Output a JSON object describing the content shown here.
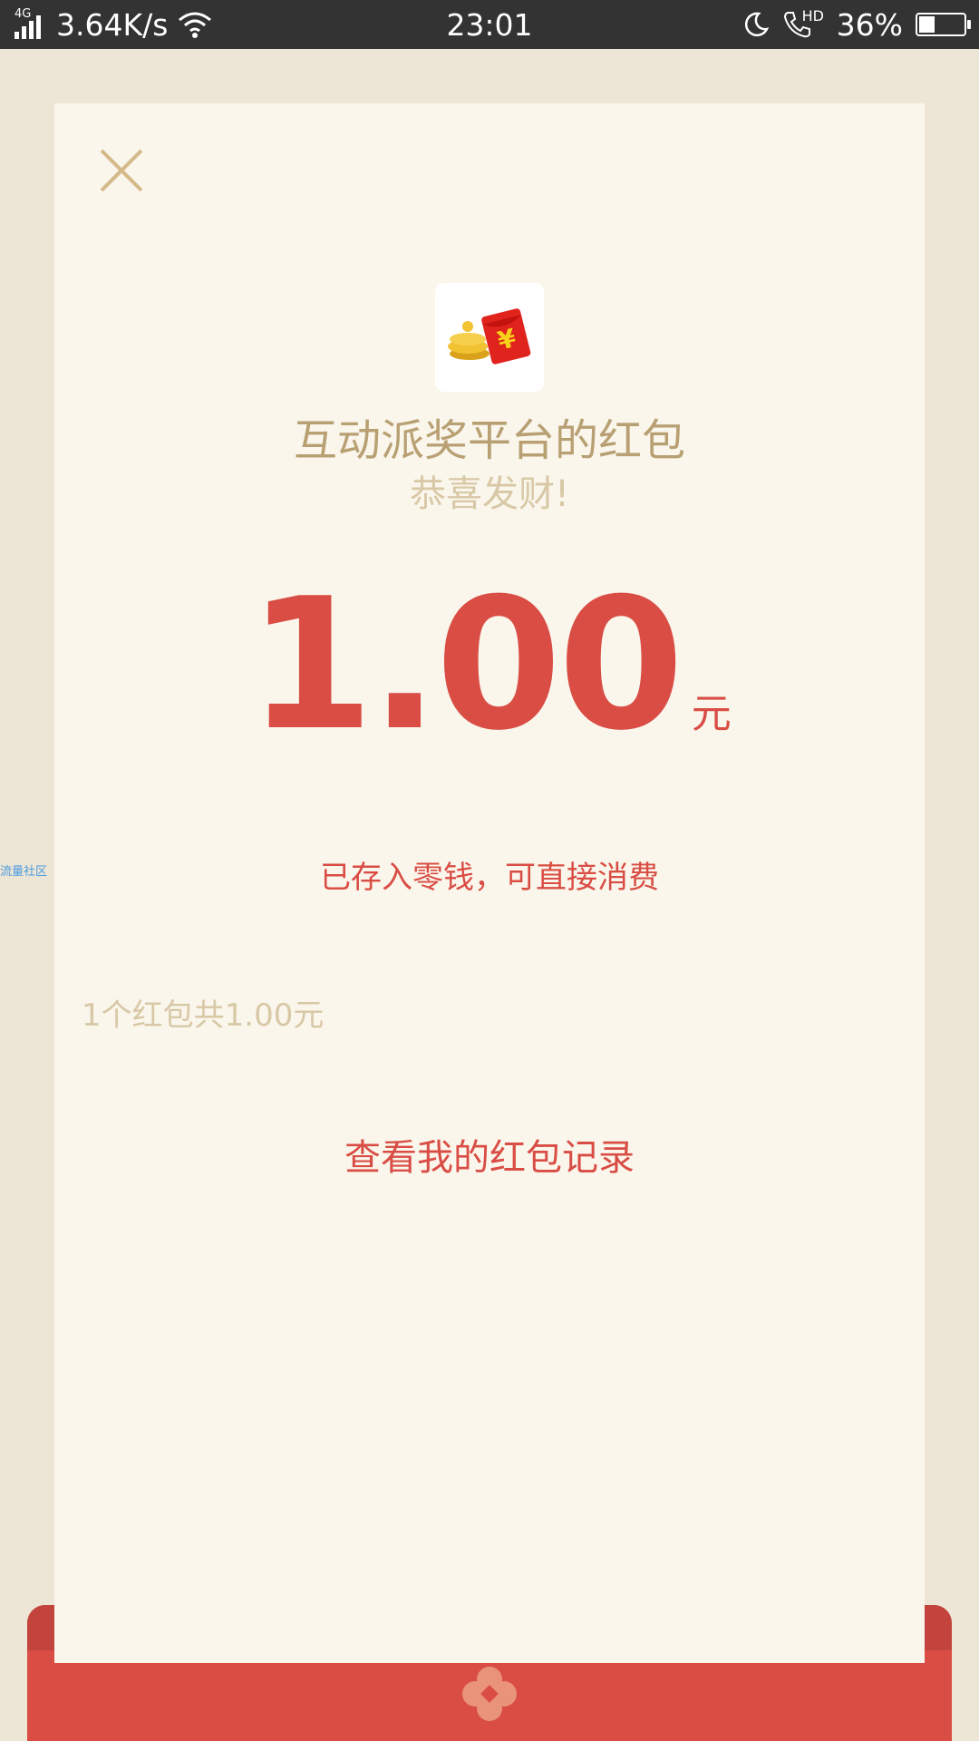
{
  "status_bar": {
    "network": "4G",
    "speed": "3.64K/s",
    "time": "23:01",
    "hd_label": "HD",
    "battery_percent": "36%",
    "battery_level": 0.36
  },
  "card": {
    "close_icon": "close-icon",
    "app_icon": "red-packet-coins-icon",
    "sender": "互动派奖平台的红包",
    "wish": "恭喜发财!",
    "amount": "1.00",
    "unit": "元",
    "saved_note": "已存入零钱，可直接消费",
    "summary": "1个红包共1.00元",
    "record_link": "查看我的红包记录"
  },
  "watermark": "流量社区",
  "colors": {
    "accent_red": "#d94d44",
    "gold": "#b8a073",
    "card_bg": "#faf6ec",
    "page_bg": "#ede5d5"
  }
}
